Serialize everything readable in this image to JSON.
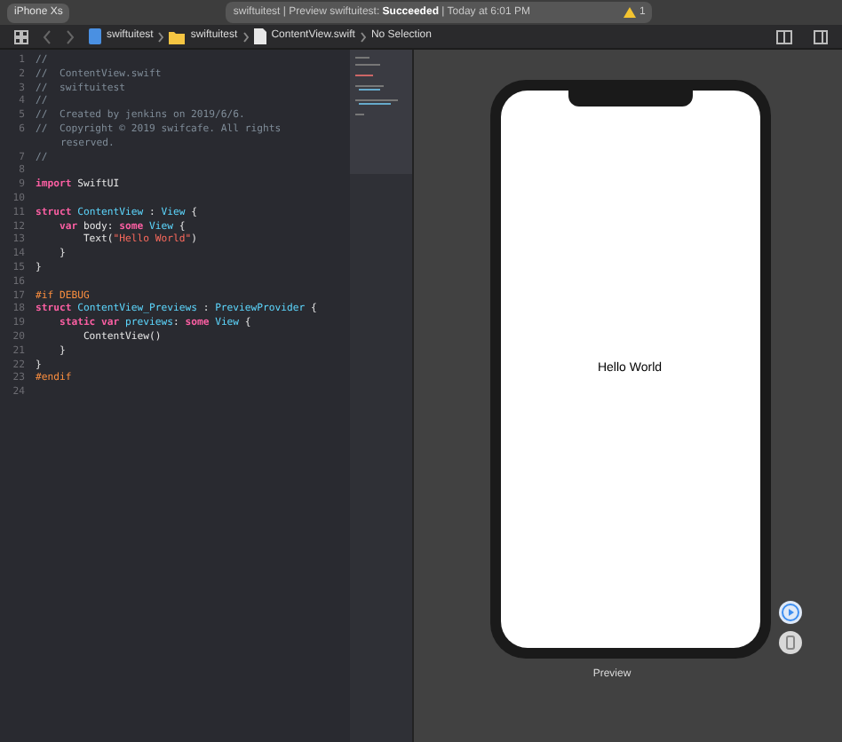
{
  "toolbar": {
    "scheme": "iPhone Xs",
    "status": {
      "project": "swiftuitest",
      "separator": "|",
      "action": "Preview swiftuitest:",
      "result": "Succeeded",
      "time": "Today at 6:01 PM"
    },
    "warnings": "1"
  },
  "jump_bar": [
    {
      "kind": "project",
      "label": "swiftuitest"
    },
    {
      "kind": "folder",
      "label": "swiftuitest"
    },
    {
      "kind": "file",
      "label": "ContentView.swift"
    },
    {
      "kind": "plain",
      "label": "No Selection"
    }
  ],
  "editor": {
    "lines": [
      {
        "number": "1",
        "tokens": [
          {
            "kind": "comment",
            "text": "//"
          }
        ]
      },
      {
        "number": "2",
        "tokens": [
          {
            "kind": "comment",
            "text": "//  ContentView.swift"
          }
        ]
      },
      {
        "number": "3",
        "tokens": [
          {
            "kind": "comment",
            "text": "//  swiftuitest"
          }
        ]
      },
      {
        "number": "4",
        "tokens": [
          {
            "kind": "comment",
            "text": "//"
          }
        ]
      },
      {
        "number": "5",
        "tokens": [
          {
            "kind": "comment",
            "text": "//  Created by jenkins on 2019/6/6."
          }
        ]
      },
      {
        "number": "6",
        "tokens": [
          {
            "kind": "comment",
            "text": "//  Copyright © 2019 swifcafe. All rights"
          }
        ],
        "wrapped": "reserved."
      },
      {
        "number": "7",
        "tokens": [
          {
            "kind": "comment",
            "text": "//"
          }
        ]
      },
      {
        "number": "8"
      },
      {
        "number": "9",
        "tokens": [
          {
            "kind": "keyword",
            "text": "import"
          },
          {
            "kind": "plain",
            "text": " SwiftUI"
          }
        ]
      },
      {
        "number": "10"
      },
      {
        "number": "11",
        "tokens": [
          {
            "kind": "keyword",
            "text": "struct"
          },
          {
            "kind": "type",
            "text": " ContentView"
          },
          {
            "kind": "plain",
            "text": " : "
          },
          {
            "kind": "type",
            "text": "View"
          },
          {
            "kind": "plain",
            "text": " {"
          }
        ]
      },
      {
        "number": "12",
        "tokens": [
          {
            "kind": "keyword",
            "text": "    var"
          },
          {
            "kind": "plain",
            "text": " body: "
          },
          {
            "kind": "keyword",
            "text": "some"
          },
          {
            "kind": "type",
            "text": " View"
          },
          {
            "kind": "plain",
            "text": " {"
          }
        ]
      },
      {
        "number": "13",
        "tokens": [
          {
            "kind": "plain",
            "text": "        Text("
          },
          {
            "kind": "string",
            "text": "\"Hello World\""
          },
          {
            "kind": "plain",
            "text": ")"
          }
        ]
      },
      {
        "number": "14",
        "tokens": [
          {
            "kind": "plain",
            "text": "    }"
          }
        ]
      },
      {
        "number": "15",
        "tokens": [
          {
            "kind": "plain",
            "text": "}"
          }
        ]
      },
      {
        "number": "16"
      },
      {
        "number": "17",
        "tokens": [
          {
            "kind": "preprocessor",
            "text": "#if DEBUG"
          }
        ]
      },
      {
        "number": "18",
        "tokens": [
          {
            "kind": "keyword",
            "text": "struct"
          },
          {
            "kind": "type",
            "text": " ContentView_Previews"
          },
          {
            "kind": "plain",
            "text": " : "
          },
          {
            "kind": "type",
            "text": "PreviewProvider"
          },
          {
            "kind": "plain",
            "text": " {"
          }
        ]
      },
      {
        "number": "19",
        "tokens": [
          {
            "kind": "keyword",
            "text": "    static var"
          },
          {
            "kind": "type",
            "text": " previews"
          },
          {
            "kind": "plain",
            "text": ": "
          },
          {
            "kind": "keyword",
            "text": "some"
          },
          {
            "kind": "type",
            "text": " View"
          },
          {
            "kind": "plain",
            "text": " {"
          }
        ]
      },
      {
        "number": "20",
        "tokens": [
          {
            "kind": "plain",
            "text": "        ContentView()"
          }
        ]
      },
      {
        "number": "21",
        "tokens": [
          {
            "kind": "plain",
            "text": "    }"
          }
        ]
      },
      {
        "number": "22",
        "tokens": [
          {
            "kind": "plain",
            "text": "}"
          }
        ]
      },
      {
        "number": "23",
        "tokens": [
          {
            "kind": "preprocessor",
            "text": "#endif"
          }
        ]
      },
      {
        "number": "24"
      }
    ]
  },
  "preview": {
    "screen_text": "Hello World",
    "caption": "Preview"
  }
}
